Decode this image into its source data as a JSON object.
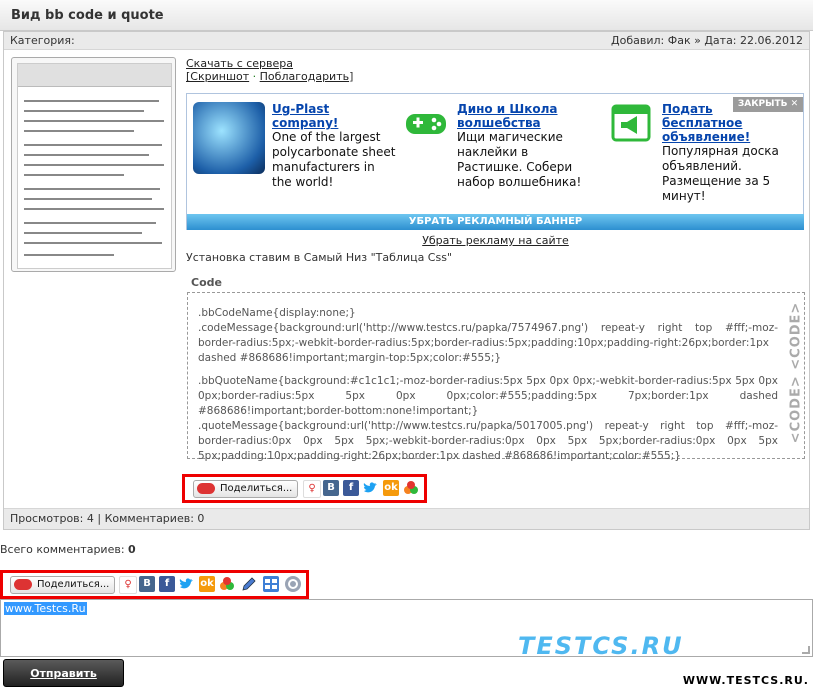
{
  "title": "Вид bb code и quote",
  "meta": {
    "category_label": "Категория:",
    "added": "Добавил: Фак » Дата: 22.06.2012"
  },
  "links": {
    "download": "Скачать с сервера",
    "screenshot": "[Скриншот",
    "dot": "·",
    "thank": "Поблагодарить",
    "close_bracket": "]"
  },
  "ad": {
    "close_label": "ЗАКРЫТЬ ✕",
    "items": [
      {
        "title": "Ug-Plast company!",
        "text": "One of the largest polycarbonate sheet manufacturers in the world!"
      },
      {
        "title": "Дино и Школа волшебства",
        "text": "Ищи магические наклейки в Растишке. Собери набор волшебника!"
      },
      {
        "title": "Подать бесплатное объявление!",
        "text": "Популярная доска объявлений. Размещение за 5 минут!"
      }
    ],
    "remove_banner": "УБРАТЬ РЕКЛАМНЫЙ БАННЕР",
    "remove_site": "Убрать рекламу на сайте"
  },
  "description": "Установка ставим в Самый Низ \"Таблица Css\"",
  "code": {
    "label": "Code",
    "side_label": "<CODE> <CODE>",
    "lines": [
      ".bbCodeName{display:none;}",
      "    .codeMessage{background:url('http://www.testcs.ru/papka/7574967.png') repeat-y right top #fff;-moz-border-radius:5px;-webkit-border-radius:5px;border-radius:5px;padding:10px;padding-right:26px;border:1px dashed #868686!important;margin-top:5px;color:#555;}",
      "",
      "    .bbQuoteName{background:#c1c1c1;-moz-border-radius:5px 5px 0px 0px;-webkit-border-radius:5px 5px 0px 0px;border-radius:5px 5px 0px 0px;color:#555;padding:5px 7px;border:1px dashed #868686!important;border-bottom:none!important;}",
      "    .quoteMessage{background:url('http://www.testcs.ru/papka/5017005.png') repeat-y right top #fff;-moz-border-radius:0px 0px 5px 5px;-webkit-border-radius:0px 0px 5px 5px;border-radius:0px 0px 5px 5px;padding:10px;padding-right:26px;border:1px dashed #868686!important;color:#555;}"
    ]
  },
  "share": {
    "label": "Поделиться...",
    "vk": "B",
    "fb": "f",
    "ok": "ok"
  },
  "stats": "Просмотров: 4 | Комментариев: 0",
  "comments": {
    "total_label": "Всего комментариев:",
    "total_value": "0"
  },
  "editor": {
    "selected_text": "www.Testcs.Ru",
    "watermark": "TESTCS.RU",
    "send_label": "Отправить"
  },
  "site_label": "WWW.TESTCS.RU.",
  "colors": {
    "ad_link": "#0645ad",
    "banner_bar": "#2d8fd0",
    "highlight_border": "#e00",
    "watermark": "#4fb8f0"
  }
}
